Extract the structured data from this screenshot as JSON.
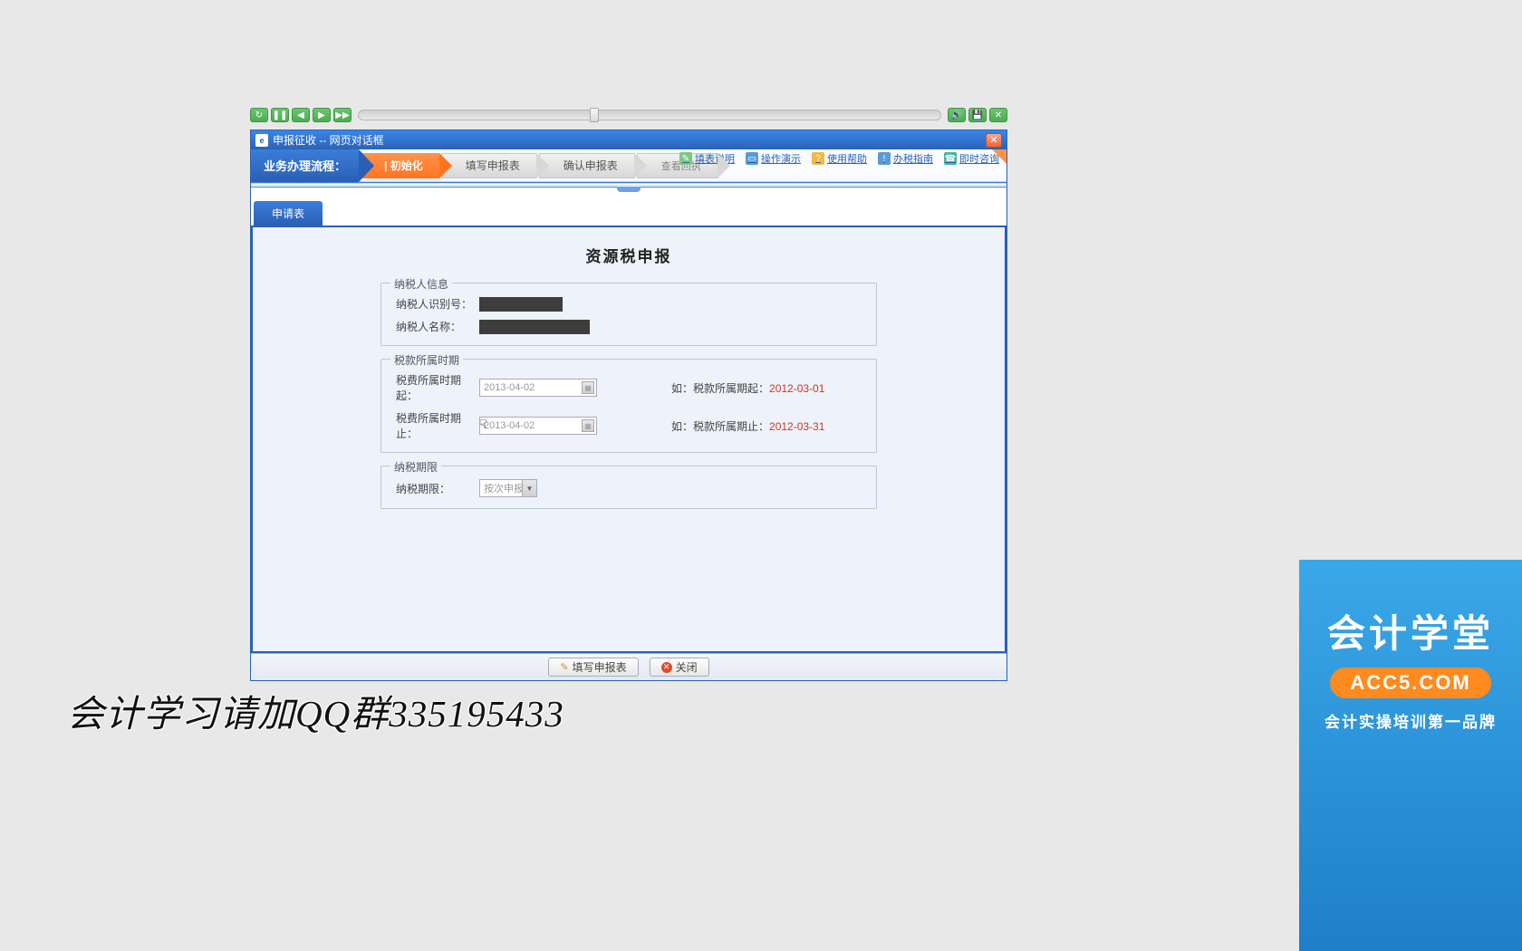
{
  "player": {},
  "titlebar": {
    "title": "申报征收 -- 网页对话框"
  },
  "workflow": {
    "label": "业务办理流程：",
    "steps": [
      "| 初始化",
      "填写申报表",
      "确认申报表",
      "查看回执"
    ]
  },
  "help_links": [
    "填表说明",
    "操作演示",
    "使用帮助",
    "办税指南",
    "即时咨询"
  ],
  "tab": {
    "active": "申请表"
  },
  "form": {
    "title": "资源税申报",
    "taxpayer": {
      "legend": "纳税人信息",
      "id_label": "纳税人识别号：",
      "name_label": "纳税人名称："
    },
    "period": {
      "legend": "税款所属时期",
      "from_label": "税费所属时期起：",
      "to_label": "税费所属时期止：",
      "from_value": "2013-04-02",
      "to_value": "2013-04-02",
      "example_from_label": "如：税款所属期起：",
      "example_to_label": "如：税款所属期止：",
      "example_from_value": "2012-03-01",
      "example_to_value": "2012-03-31"
    },
    "deadline": {
      "legend": "纳税期限",
      "label": "纳税期限：",
      "value": "按次申报"
    }
  },
  "buttons": {
    "fill": "填写申报表",
    "close": "关闭"
  },
  "footer_text": "会计学习请加QQ群335195433",
  "logo": {
    "line1": "会计学堂",
    "line2": "ACC5.COM",
    "line3": "会计实操培训第一品牌"
  }
}
